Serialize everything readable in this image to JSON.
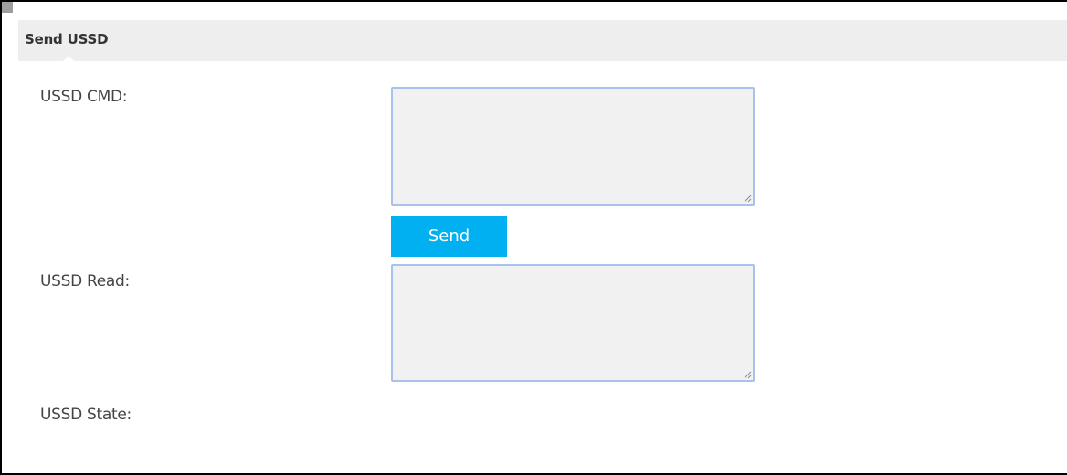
{
  "section": {
    "title": "Send USSD"
  },
  "form": {
    "cmd_label": "USSD CMD:",
    "cmd_value": "",
    "send_label": "Send",
    "read_label": "USSD Read:",
    "read_value": "",
    "state_label": "USSD State:"
  },
  "colors": {
    "accent": "#00b0f0",
    "input_border": "#a9c2ec",
    "input_background": "#f1f1f1",
    "header_background": "#eeeeee"
  },
  "icons": {
    "resize": "resize-grip-icon"
  }
}
